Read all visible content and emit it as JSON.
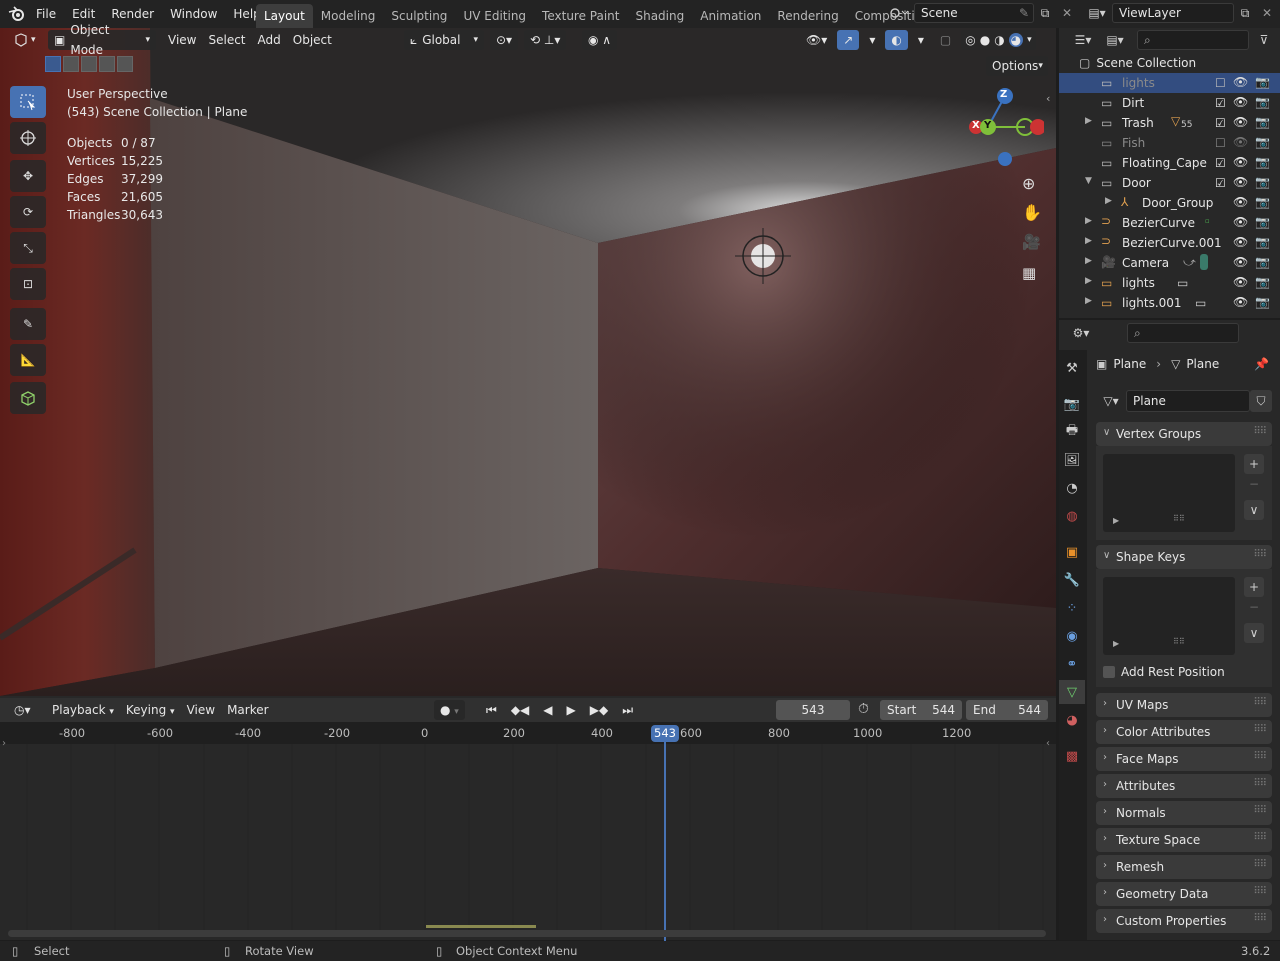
{
  "topbar": {
    "menus": [
      "File",
      "Edit",
      "Render",
      "Window",
      "Help"
    ],
    "workspaces": [
      "Layout",
      "Modeling",
      "Sculpting",
      "UV Editing",
      "Texture Paint",
      "Shading",
      "Animation",
      "Rendering",
      "Compositing"
    ],
    "active_workspace": "Layout",
    "scene": "Scene",
    "view_layer": "ViewLayer"
  },
  "viewport_header": {
    "mode": "Object Mode",
    "menus": [
      "View",
      "Select",
      "Add",
      "Object"
    ],
    "transform_orientation": "Global",
    "options_label": "Options"
  },
  "viewport_overlay": {
    "perspective": "User Perspective",
    "context": "(543) Scene Collection | Plane",
    "stats": [
      {
        "label": "Objects",
        "value": "0 / 87"
      },
      {
        "label": "Vertices",
        "value": "15,225"
      },
      {
        "label": "Edges",
        "value": "37,299"
      },
      {
        "label": "Faces",
        "value": "21,605"
      },
      {
        "label": "Triangles",
        "value": "30,643"
      }
    ],
    "gizmo": {
      "z": "Z",
      "y": "Y",
      "x": "X"
    }
  },
  "timeline": {
    "menus": [
      "Playback",
      "Keying",
      "View",
      "Marker"
    ],
    "current_frame": "543",
    "start_label": "Start",
    "start": "544",
    "end_label": "End",
    "end": "544",
    "ticks": [
      "-800",
      "-600",
      "-400",
      "-200",
      "0",
      "200",
      "400",
      "600",
      "800",
      "1000",
      "1200"
    ],
    "playhead_label": "543"
  },
  "outliner": {
    "root": "Scene Collection",
    "rows": [
      {
        "name": "lights",
        "selected": true,
        "dim": true
      },
      {
        "name": "Dirt"
      },
      {
        "name": "Trash",
        "badge": "55"
      },
      {
        "name": "Fish",
        "dim": true
      },
      {
        "name": "Floating_Cape"
      },
      {
        "name": "Door"
      },
      {
        "name": "Door_Group"
      },
      {
        "name": "BezierCurve"
      },
      {
        "name": "BezierCurve.001"
      },
      {
        "name": "Camera"
      },
      {
        "name": "lights"
      },
      {
        "name": "lights.001"
      }
    ]
  },
  "properties": {
    "breadcrumb_object": "Plane",
    "breadcrumb_data": "Plane",
    "mesh_name": "Plane",
    "vertex_groups": "Vertex Groups",
    "shape_keys": "Shape Keys",
    "add_rest_position": "Add Rest Position",
    "panels": [
      "UV Maps",
      "Color Attributes",
      "Face Maps",
      "Attributes",
      "Normals",
      "Texture Space",
      "Remesh",
      "Geometry Data",
      "Custom Properties"
    ]
  },
  "statusbar": {
    "select": "Select",
    "rotate": "Rotate View",
    "context_menu": "Object Context Menu",
    "version": "3.6.2"
  },
  "colors": {
    "accent": "#4772b3",
    "selection": "#334d80",
    "playhead": "#4772b3"
  }
}
